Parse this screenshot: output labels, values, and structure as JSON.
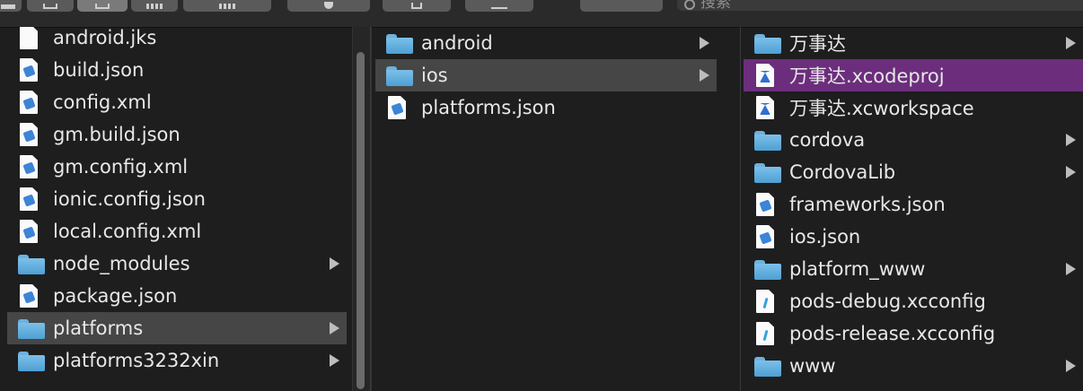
{
  "toolbar": {
    "search_placeholder": "搜索",
    "buttons": [
      "view-icons-icon",
      "view-list-icon",
      "view-columns-icon",
      "view-gallery-icon",
      "group-icon",
      "action-gear-icon",
      "share-icon",
      "tags-icon"
    ]
  },
  "colors": {
    "background": "#1e1e1e",
    "selection_inactive": "#464646",
    "selection_active": "#6c2e7c",
    "folder": "#5aa8dc"
  },
  "columns": [
    {
      "items": [
        {
          "label": "android.jks",
          "icon": "document-icon",
          "folder": false
        },
        {
          "label": "build.json",
          "icon": "json-file-icon",
          "folder": false
        },
        {
          "label": "config.xml",
          "icon": "xml-file-icon",
          "folder": false
        },
        {
          "label": "gm.build.json",
          "icon": "json-file-icon",
          "folder": false
        },
        {
          "label": "gm.config.xml",
          "icon": "xml-file-icon",
          "folder": false
        },
        {
          "label": "ionic.config.json",
          "icon": "json-file-icon",
          "folder": false
        },
        {
          "label": "local.config.xml",
          "icon": "xml-file-icon",
          "folder": false
        },
        {
          "label": "node_modules",
          "icon": "folder-icon",
          "folder": true
        },
        {
          "label": "package.json",
          "icon": "json-file-icon",
          "folder": false
        },
        {
          "label": "platforms",
          "icon": "folder-icon",
          "folder": true,
          "selected": true
        },
        {
          "label": "platforms3232xin",
          "icon": "folder-icon",
          "folder": true
        }
      ]
    },
    {
      "items": [
        {
          "label": "android",
          "icon": "folder-icon",
          "folder": true
        },
        {
          "label": "ios",
          "icon": "folder-icon",
          "folder": true,
          "selected": true
        },
        {
          "label": "platforms.json",
          "icon": "json-file-icon",
          "folder": false
        }
      ]
    },
    {
      "items": [
        {
          "label": "万事达",
          "icon": "folder-icon",
          "folder": true
        },
        {
          "label": "万事达.xcodeproj",
          "icon": "xcodeproj-icon",
          "folder": false,
          "active": true
        },
        {
          "label": "万事达.xcworkspace",
          "icon": "xcworkspace-icon",
          "folder": false
        },
        {
          "label": "cordova",
          "icon": "folder-icon",
          "folder": true
        },
        {
          "label": "CordovaLib",
          "icon": "folder-icon",
          "folder": true
        },
        {
          "label": "frameworks.json",
          "icon": "json-file-icon",
          "folder": false
        },
        {
          "label": "ios.json",
          "icon": "json-file-icon",
          "folder": false
        },
        {
          "label": "platform_www",
          "icon": "folder-icon",
          "folder": true
        },
        {
          "label": "pods-debug.xcconfig",
          "icon": "xcconfig-icon",
          "folder": false
        },
        {
          "label": "pods-release.xcconfig",
          "icon": "xcconfig-icon",
          "folder": false
        },
        {
          "label": "www",
          "icon": "folder-icon",
          "folder": true
        }
      ]
    }
  ]
}
